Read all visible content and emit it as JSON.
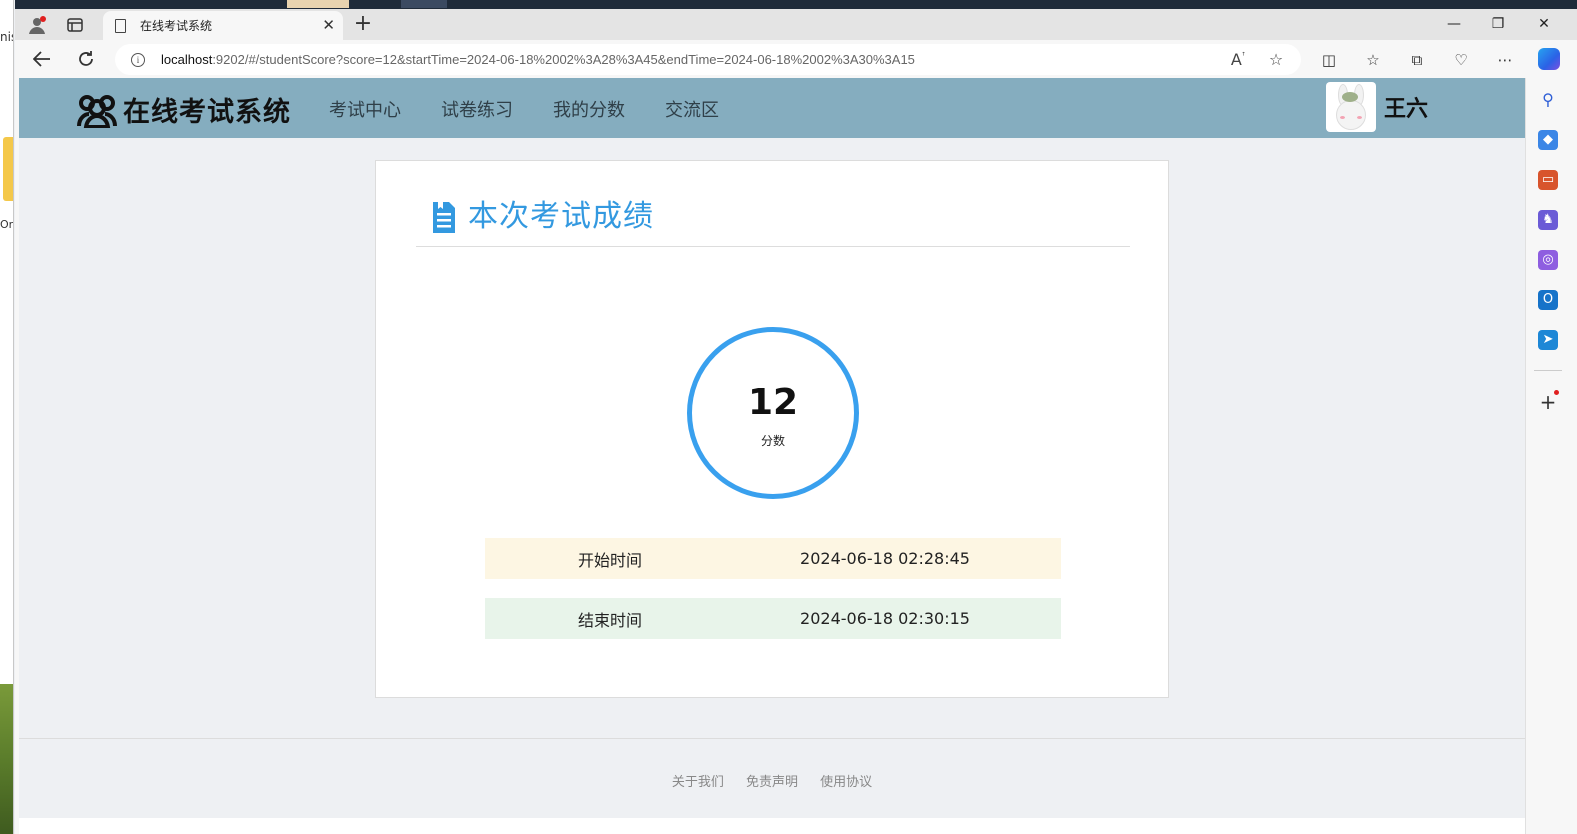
{
  "desktop": {
    "left_text_1": "nis",
    "left_text_2": "Or"
  },
  "browser": {
    "tab": {
      "title": "在线考试系统"
    },
    "url_host": "localhost",
    "url_rest": ":9202/#/studentScore?score=12&startTime=2024-06-18%2002%3A28%3A45&endTime=2024-06-18%2002%3A30%3A15"
  },
  "site": {
    "logo_text": "在线考试系统",
    "nav": [
      {
        "label": "考试中心"
      },
      {
        "label": "试卷练习"
      },
      {
        "label": "我的分数"
      },
      {
        "label": "交流区"
      }
    ],
    "user_name": "王六"
  },
  "result": {
    "title": "本次考试成绩",
    "score": "12",
    "score_label": "分数",
    "start_label": "开始时间",
    "start_time": "2024-06-18 02:28:45",
    "end_label": "结束时间",
    "end_time": "2024-06-18 02:30:15",
    "colors": {
      "accent": "#39a0ee",
      "start_row": "#fdf6e3",
      "end_row": "#e8f4ea",
      "header": "#85adbf"
    }
  },
  "footer": {
    "links": [
      {
        "label": "关于我们"
      },
      {
        "label": "免责声明"
      },
      {
        "label": "使用协议"
      }
    ]
  }
}
